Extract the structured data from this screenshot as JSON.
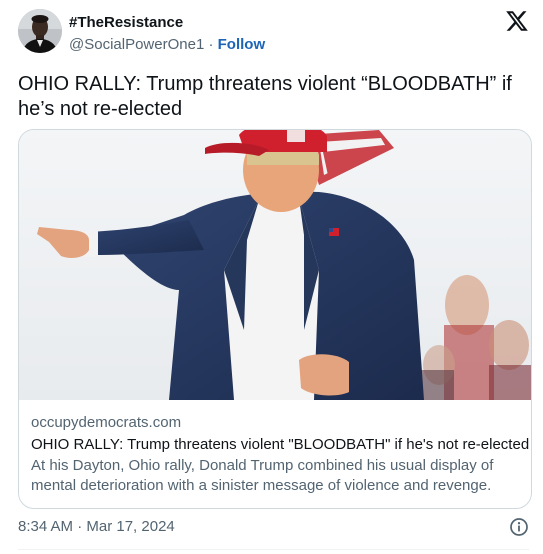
{
  "author": {
    "display_name": "#TheResistance",
    "handle": "@SocialPowerOne1",
    "separator": " · ",
    "follow_label": "Follow"
  },
  "tweet": {
    "text": "OHIO RALLY: Trump threatens violent “BLOODBATH” if he’s not re-elected",
    "timestamp": "8:34 AM · Mar 17, 2024"
  },
  "card": {
    "domain": "occupydemocrats.com",
    "title": "OHIO RALLY: Trump threatens violent \"BLOODBATH\" if he's not re-elected",
    "description": "At his Dayton, Ohio rally, Donald Trump combined his usual display of mental deterioration with a sinister message of violence and revenge."
  },
  "icons": {
    "platform_logo": "x-logo-icon",
    "info": "info-icon"
  },
  "colors": {
    "text_primary": "#0f1419",
    "text_secondary": "#536471",
    "follow_link": "#1d64b7",
    "card_border": "#cfd9de"
  }
}
